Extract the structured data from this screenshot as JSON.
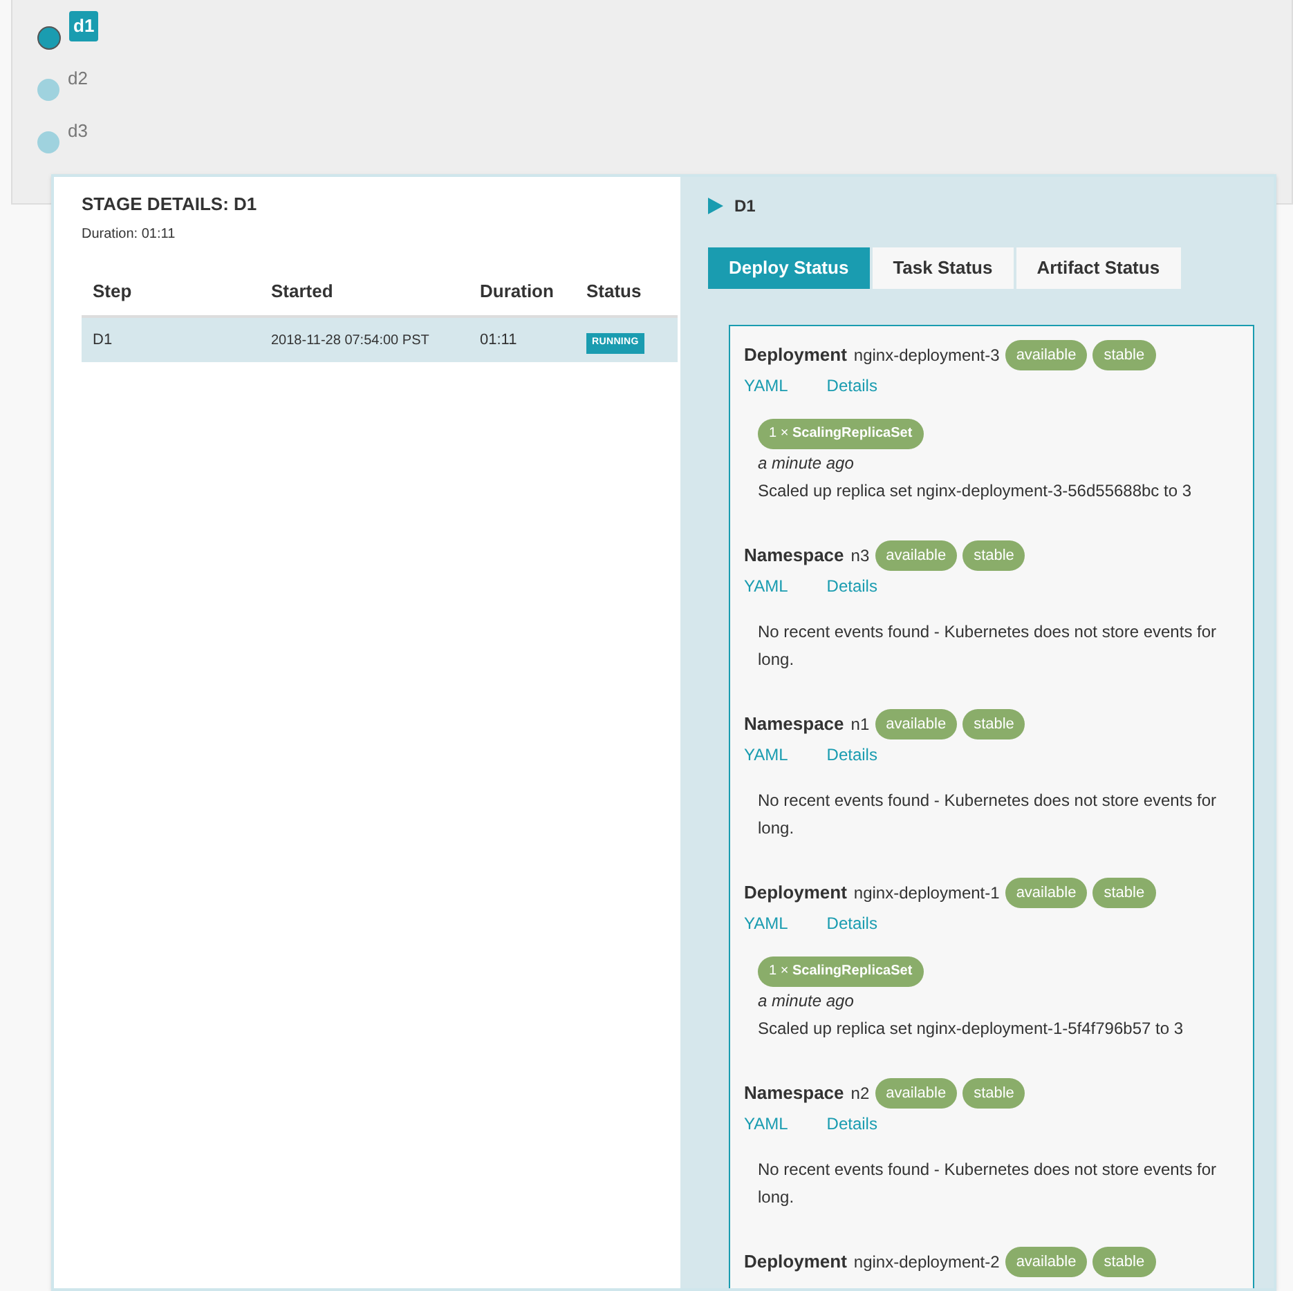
{
  "stages": [
    {
      "label": "d1",
      "selected": true
    },
    {
      "label": "d2",
      "selected": false
    },
    {
      "label": "d3",
      "selected": false
    }
  ],
  "stage_details": {
    "title": "STAGE DETAILS: D1",
    "duration": "Duration: 01:11",
    "columns": [
      "Step",
      "Started",
      "Duration",
      "Status"
    ],
    "rows": [
      {
        "step": "D1",
        "started": "2018-11-28 07:54:00 PST",
        "duration": "01:11",
        "status": "RUNNING",
        "selected": true
      }
    ]
  },
  "detail": {
    "title": "D1",
    "tabs": [
      {
        "label": "Deploy Status",
        "selected": true
      },
      {
        "label": "Task Status",
        "selected": false
      },
      {
        "label": "Artifact Status",
        "selected": false
      }
    ],
    "resources": [
      {
        "kind": "Deployment",
        "name": "nginx-deployment-3",
        "tags": [
          "available",
          "stable"
        ],
        "links": [
          "YAML",
          "Details"
        ],
        "events": [
          {
            "badge": "1 × **ScalingReplicaSet**",
            "time": "a minute ago",
            "message": "Scaled up replica set nginx-deployment-3-56d55688bc to 3"
          }
        ]
      },
      {
        "kind": "Namespace",
        "name": "n3",
        "tags": [
          "available",
          "stable"
        ],
        "links": [
          "YAML",
          "Details"
        ],
        "empty_message": "No recent events found - Kubernetes does not store events for long."
      },
      {
        "kind": "Namespace",
        "name": "n1",
        "tags": [
          "available",
          "stable"
        ],
        "links": [
          "YAML",
          "Details"
        ],
        "empty_message": "No recent events found - Kubernetes does not store events for long."
      },
      {
        "kind": "Deployment",
        "name": "nginx-deployment-1",
        "tags": [
          "available",
          "stable"
        ],
        "links": [
          "YAML",
          "Details"
        ],
        "events": [
          {
            "badge": "1 × **ScalingReplicaSet**",
            "time": "a minute ago",
            "message": "Scaled up replica set nginx-deployment-1-5f4f796b57 to 3"
          }
        ]
      },
      {
        "kind": "Namespace",
        "name": "n2",
        "tags": [
          "available",
          "stable"
        ],
        "links": [
          "YAML",
          "Details"
        ],
        "empty_message": "No recent events found - Kubernetes does not store events for long."
      },
      {
        "kind": "Deployment",
        "name": "nginx-deployment-2",
        "tags": [
          "available",
          "stable"
        ]
      }
    ]
  }
}
